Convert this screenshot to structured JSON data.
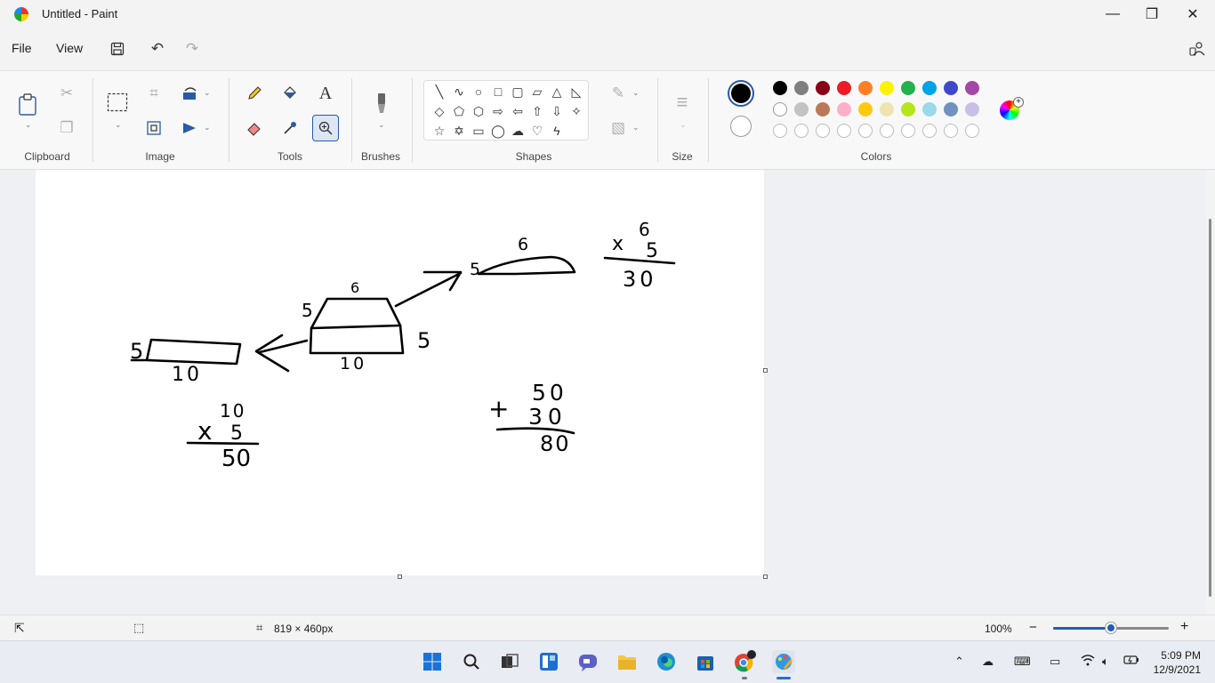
{
  "window": {
    "title": "Untitled - Paint",
    "minimize": "—",
    "maximize": "❐",
    "close": "✕"
  },
  "menu": {
    "file": "File",
    "view": "View"
  },
  "ribbon": {
    "groups": {
      "clipboard": "Clipboard",
      "image": "Image",
      "tools": "Tools",
      "brushes": "Brushes",
      "shapes": "Shapes",
      "size": "Size",
      "colors": "Colors"
    },
    "text_tool": "A",
    "primary_color": "#000000",
    "secondary_color": "#ffffff",
    "palette_row1": [
      "#000000",
      "#7f7f7f",
      "#880015",
      "#ed1c24",
      "#ff7f27",
      "#fff200",
      "#22b14c",
      "#00a2e8",
      "#3f48cc",
      "#a349a4"
    ],
    "palette_row2": [
      "#ffffff",
      "#c3c3c3",
      "#b97a57",
      "#ffaec9",
      "#ffc90e",
      "#efe4b0",
      "#b5e61d",
      "#99d9ea",
      "#7092be",
      "#c8bfe7"
    ]
  },
  "canvas": {
    "size_label": "819 × 460px"
  },
  "drawing": {
    "labels": {
      "top_small_dim6": "6",
      "top_small_dim5": "5",
      "calc1_a": "6",
      "calc1_op": "x",
      "calc1_b": "5",
      "calc1_res": "30",
      "mid_top6": "6",
      "mid_left5": "5",
      "mid_right5": "5",
      "mid_bottom10": "10",
      "left_dim5": "5",
      "left_dim10": "10",
      "calc2_a": "10",
      "calc2_op": "x",
      "calc2_b": "5",
      "calc2_res": "50",
      "sum_a": "50",
      "sum_op": "+",
      "sum_b": "30",
      "sum_res": "80"
    }
  },
  "status": {
    "canvas_size": "819 × 460px",
    "zoom": "100%",
    "zoom_percent": 100,
    "zoom_minus": "−",
    "zoom_plus": "+"
  },
  "taskbar": {
    "time": "5:09 PM",
    "date": "12/9/2021"
  }
}
